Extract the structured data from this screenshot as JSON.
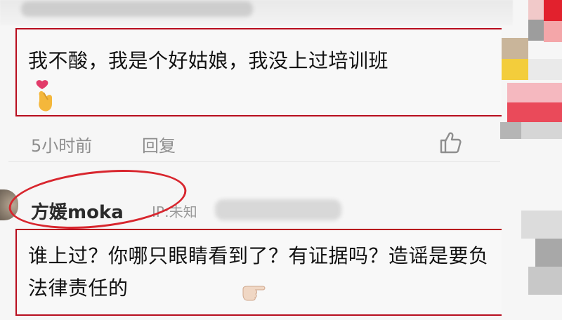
{
  "comments": [
    {
      "text": "我不酸，我是个好姑娘，我没上过培训班",
      "emoji": "heart-hand",
      "time": "5小时前",
      "reply_label": "回复"
    },
    {
      "username": "方媛moka",
      "ip": "IP:未知",
      "text": "谁上过？你哪只眼睛看到了？有证据吗？造谣是要负法律责任的",
      "emoji": "pointing-hand"
    }
  ],
  "colors": {
    "highlight_box": "#b80d1e",
    "circle_mark": "#d8262e",
    "meta_text": "#8e8e8e"
  }
}
